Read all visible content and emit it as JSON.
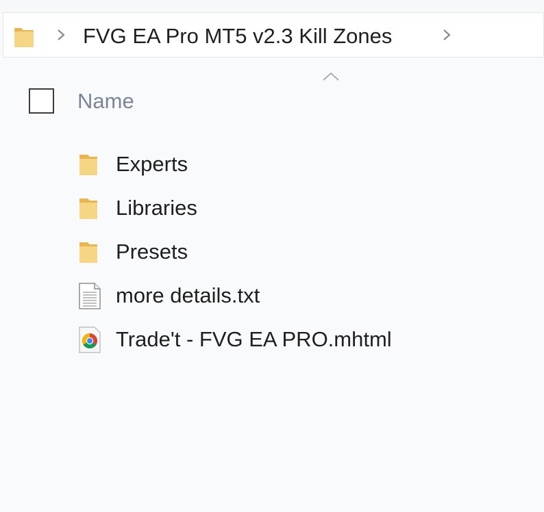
{
  "address_bar": {
    "crumb": "FVG EA Pro MT5 v2.3 Kill Zones",
    "folder_icon": "folder-icon",
    "separator_icon": "chevron-right-icon"
  },
  "column_header": {
    "name_label": "Name",
    "sort_icon": "chevron-up-icon",
    "select_all": "checkbox-icon"
  },
  "files": [
    {
      "name": "Experts",
      "icon": "folder-icon"
    },
    {
      "name": "Libraries",
      "icon": "folder-icon"
    },
    {
      "name": "Presets",
      "icon": "folder-icon"
    },
    {
      "name": "more details.txt",
      "icon": "text-file-icon"
    },
    {
      "name": "Trade't - FVG EA PRO.mhtml",
      "icon": "chrome-icon"
    }
  ],
  "colors": {
    "background": "#f9fafb",
    "folder": "#f3d27a",
    "header_text": "#7a8698",
    "text": "#1f1f1f"
  }
}
